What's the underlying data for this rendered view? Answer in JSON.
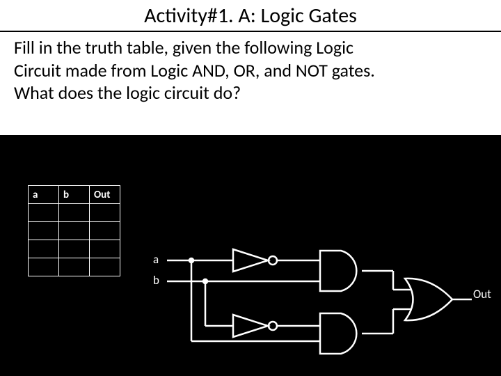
{
  "title": "Activity#1. A: Logic Gates",
  "instructions_line1": "Fill in the truth table, given the following Logic",
  "instructions_line2": "Circuit made from Logic AND, OR, and NOT gates.",
  "instructions_line3": "What does the logic circuit do?",
  "table": {
    "headers": [
      "a",
      "b",
      "Out"
    ]
  },
  "diagram": {
    "input_a": "a",
    "input_b": "b",
    "output": "Out"
  }
}
